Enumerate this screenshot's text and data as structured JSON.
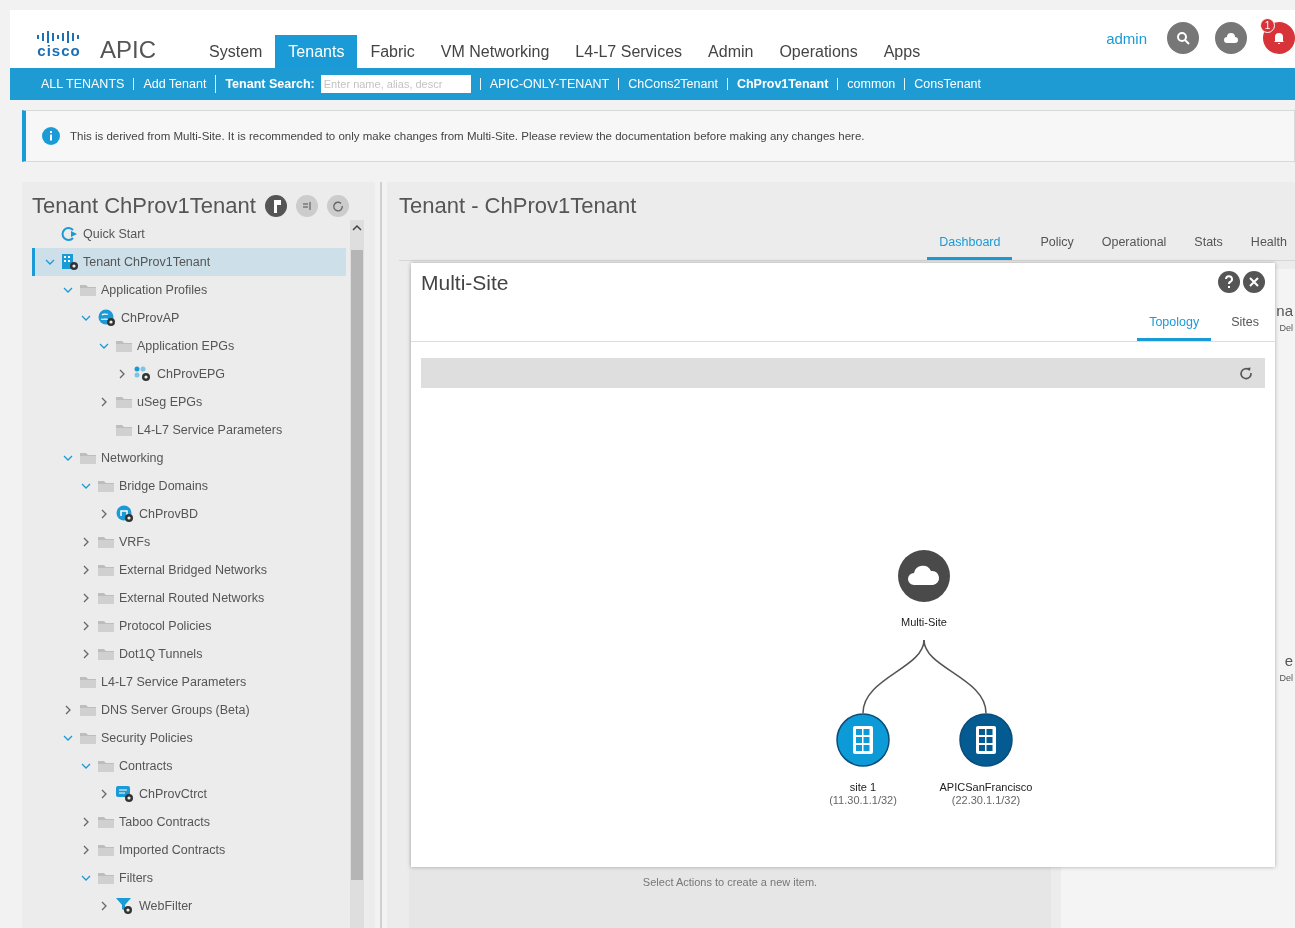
{
  "header": {
    "logo_word": "cisco",
    "product": "APIC",
    "nav": [
      {
        "label": "System",
        "selected": false
      },
      {
        "label": "Tenants",
        "selected": true
      },
      {
        "label": "Fabric",
        "selected": false
      },
      {
        "label": "VM Networking",
        "selected": false
      },
      {
        "label": "L4-L7 Services",
        "selected": false
      },
      {
        "label": "Admin",
        "selected": false
      },
      {
        "label": "Operations",
        "selected": false
      },
      {
        "label": "Apps",
        "selected": false
      }
    ],
    "user": "admin",
    "alert_count": "1"
  },
  "subnav": {
    "items": [
      {
        "kind": "link",
        "label": "ALL TENANTS",
        "selected": false
      },
      {
        "kind": "link",
        "label": "Add Tenant",
        "selected": false
      },
      {
        "kind": "search",
        "label": "Tenant Search:",
        "placeholder": "Enter name, alias, descr"
      },
      {
        "kind": "link",
        "label": "APIC-ONLY-TENANT",
        "selected": false
      },
      {
        "kind": "link",
        "label": "ChCons2Tenant",
        "selected": false
      },
      {
        "kind": "link",
        "label": "ChProv1Tenant",
        "selected": true
      },
      {
        "kind": "link",
        "label": "common",
        "selected": false
      },
      {
        "kind": "link",
        "label": "ConsTenant",
        "selected": false
      }
    ]
  },
  "banner": {
    "text": "This is derived from Multi-Site. It is recommended to only make changes from Multi-Site. Please review the documentation before making any changes here."
  },
  "sidebar": {
    "title": "Tenant ChProv1Tenant",
    "quick_start": "Quick Start",
    "tree": [
      {
        "label": "Tenant ChProv1Tenant",
        "kind": "tenant",
        "selected": true,
        "expanded": true,
        "children": [
          {
            "label": "Application Profiles",
            "kind": "folder",
            "selected": false,
            "expanded": true,
            "children": [
              {
                "label": "ChProvAP",
                "kind": "app-profile",
                "selected": false,
                "expanded": true,
                "children": [
                  {
                    "label": "Application EPGs",
                    "kind": "folder",
                    "selected": false,
                    "expanded": true,
                    "children": [
                      {
                        "label": "ChProvEPG",
                        "kind": "epg",
                        "selected": false,
                        "expanded": false
                      }
                    ]
                  },
                  {
                    "label": "uSeg EPGs",
                    "kind": "folder",
                    "selected": false,
                    "expanded": false
                  },
                  {
                    "label": "L4-L7 Service Parameters",
                    "kind": "folder",
                    "selected": false
                  }
                ]
              }
            ]
          },
          {
            "label": "Networking",
            "kind": "folder",
            "selected": false,
            "expanded": true,
            "children": [
              {
                "label": "Bridge Domains",
                "kind": "folder",
                "selected": false,
                "expanded": true,
                "children": [
                  {
                    "label": "ChProvBD",
                    "kind": "bridge-domain",
                    "selected": false,
                    "expanded": false
                  }
                ]
              },
              {
                "label": "VRFs",
                "kind": "folder",
                "selected": false,
                "expanded": false
              },
              {
                "label": "External Bridged Networks",
                "kind": "folder",
                "selected": false,
                "expanded": false
              },
              {
                "label": "External Routed Networks",
                "kind": "folder",
                "selected": false,
                "expanded": false
              },
              {
                "label": "Protocol Policies",
                "kind": "folder",
                "selected": false,
                "expanded": false
              },
              {
                "label": "Dot1Q Tunnels",
                "kind": "folder",
                "selected": false,
                "expanded": false
              }
            ]
          },
          {
            "label": "L4-L7 Service Parameters",
            "kind": "folder",
            "selected": false
          },
          {
            "label": "DNS Server Groups (Beta)",
            "kind": "folder",
            "selected": false,
            "expanded": false
          },
          {
            "label": "Security Policies",
            "kind": "folder",
            "selected": false,
            "expanded": true,
            "children": [
              {
                "label": "Contracts",
                "kind": "folder",
                "selected": false,
                "expanded": true,
                "children": [
                  {
                    "label": "ChProvCtrct",
                    "kind": "contract",
                    "selected": false,
                    "expanded": false
                  }
                ]
              },
              {
                "label": "Taboo Contracts",
                "kind": "folder",
                "selected": false,
                "expanded": false
              },
              {
                "label": "Imported Contracts",
                "kind": "folder",
                "selected": false,
                "expanded": false
              },
              {
                "label": "Filters",
                "kind": "folder",
                "selected": false,
                "expanded": true,
                "children": [
                  {
                    "label": "WebFilter",
                    "kind": "filter",
                    "selected": false,
                    "expanded": false
                  }
                ]
              }
            ]
          }
        ]
      }
    ]
  },
  "content": {
    "title": "Tenant - ChProv1Tenant",
    "tabs": [
      {
        "label": "Dashboard",
        "selected": true
      },
      {
        "label": "Policy",
        "selected": false
      },
      {
        "label": "Operational",
        "selected": false
      },
      {
        "label": "Stats",
        "selected": false
      },
      {
        "label": "Health",
        "selected": false
      }
    ],
    "footer_hint": "Select Actions to create a new item.",
    "edge_fragments": [
      "na",
      "Del",
      "e",
      "Del"
    ]
  },
  "modal": {
    "title": "Multi-Site",
    "tabs": [
      {
        "label": "Topology",
        "selected": true
      },
      {
        "label": "Sites",
        "selected": false
      }
    ],
    "topology": {
      "root": {
        "label": "Multi-Site"
      },
      "sites": [
        {
          "name": "site 1",
          "address": "(11.30.1.1/32)",
          "color": "#0d9bd7"
        },
        {
          "name": "APICSanFrancisco",
          "address": "(22.30.1.1/32)",
          "color": "#045b92"
        }
      ]
    }
  }
}
